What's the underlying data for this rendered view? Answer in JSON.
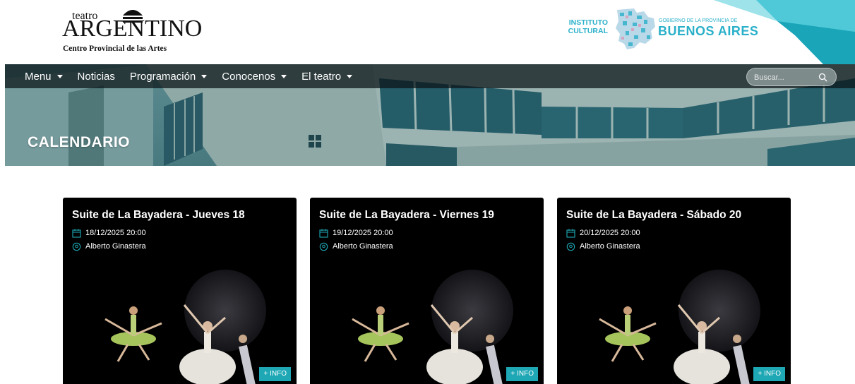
{
  "brand": {
    "logo_small": "teatro",
    "logo_main": "ARGENTINO",
    "logo_sub": "Centro Provincial de las Artes"
  },
  "partner": {
    "instituto": "INSTITUTO CULTURAL",
    "gobierno_small": "GOBIERNO DE LA PROVINCIA DE",
    "gobierno_big": "BUENOS AIRES"
  },
  "nav": {
    "items": [
      {
        "label": "Menu",
        "dropdown": true
      },
      {
        "label": "Noticias",
        "dropdown": false
      },
      {
        "label": "Programación",
        "dropdown": true
      },
      {
        "label": "Conocenos",
        "dropdown": true
      },
      {
        "label": "El teatro",
        "dropdown": true
      }
    ],
    "search_placeholder": "Buscar..."
  },
  "hero": {
    "title": "CALENDARIO"
  },
  "cards": [
    {
      "title": "Suite de La Bayadera - Jueves 18",
      "datetime": "18/12/2025 20:00",
      "venue": "Alberto Ginastera",
      "button": "+ INFO"
    },
    {
      "title": "Suite de La Bayadera - Viernes 19",
      "datetime": "19/12/2025 20:00",
      "venue": "Alberto Ginastera",
      "button": "+ INFO"
    },
    {
      "title": "Suite de La Bayadera - Sábado 20",
      "datetime": "20/12/2025 20:00",
      "venue": "Alberto Ginastera",
      "button": "+ INFO"
    }
  ],
  "colors": {
    "accent": "#1ea7b4",
    "partner": "#2ab0c9",
    "card_bg": "#000000",
    "nav_bg": "#0a1416"
  }
}
